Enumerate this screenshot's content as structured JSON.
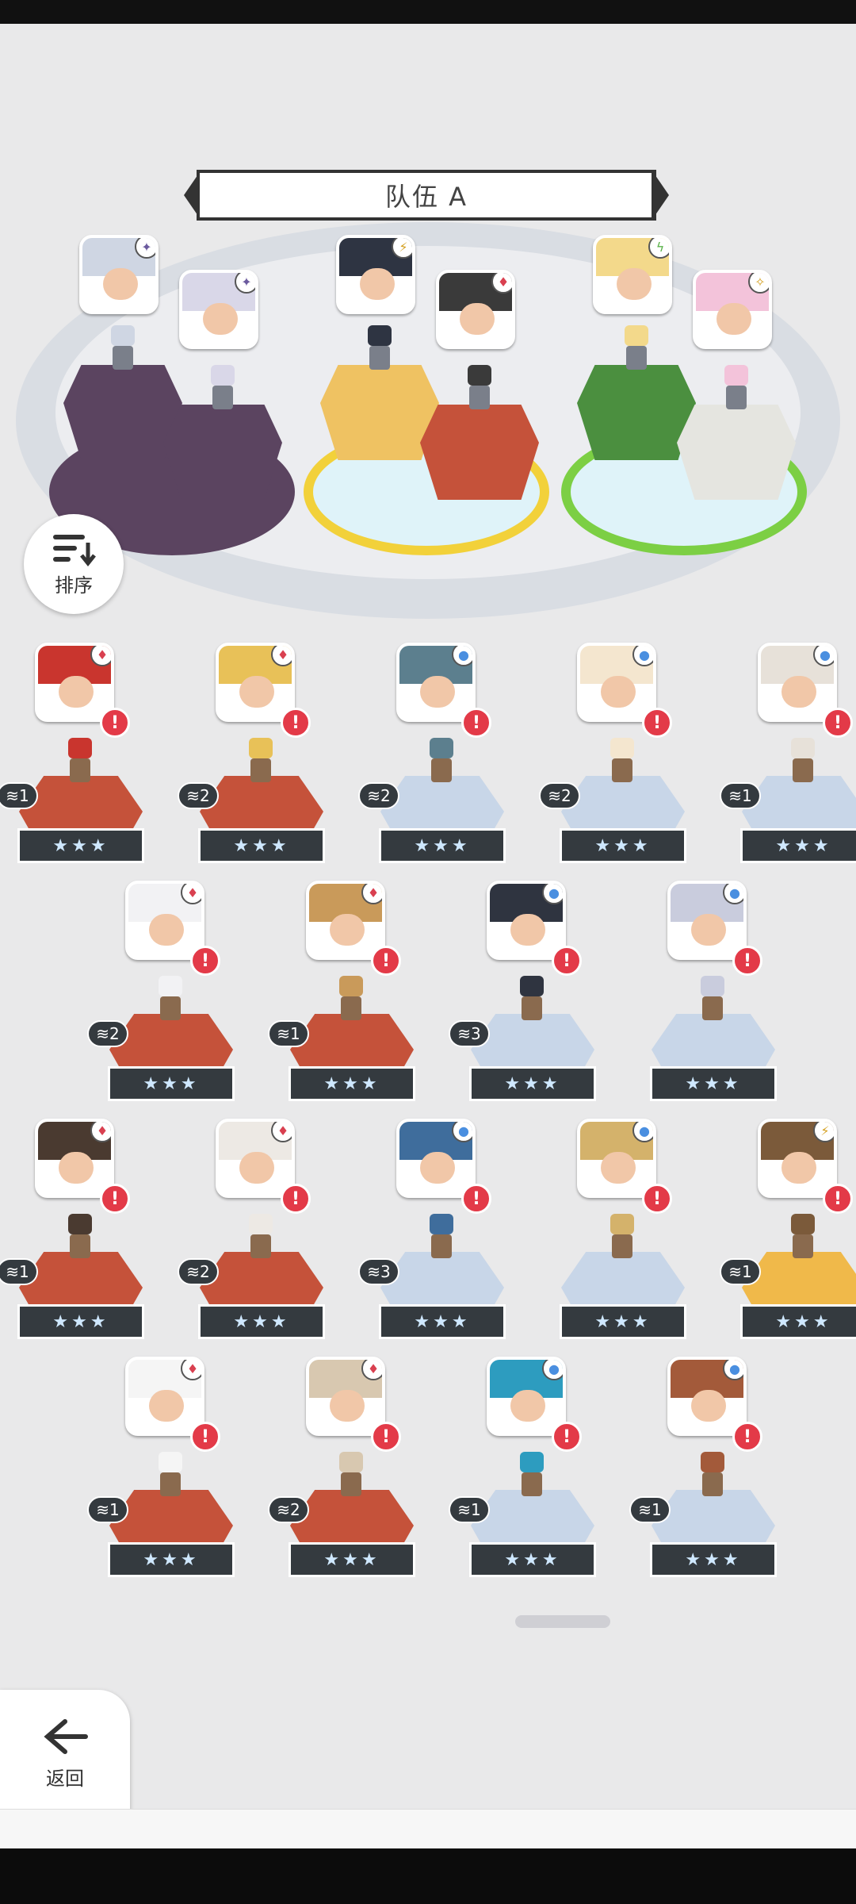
{
  "team": {
    "title": "队伍 A",
    "slots": [
      {
        "portrait_hair": "#cfd6e3",
        "elem": "✦",
        "elem_color": "#6b5a9e"
      },
      {
        "portrait_hair": "#d9d7e8",
        "elem": "✦",
        "elem_color": "#6b5a9e"
      },
      {
        "portrait_hair": "#2e3442",
        "elem": "⚡",
        "elem_color": "#d4a020"
      },
      {
        "portrait_hair": "#3a3a3a",
        "elem": "♦",
        "elem_color": "#d94050"
      },
      {
        "portrait_hair": "#f3d98b",
        "elem": "ϟ",
        "elem_color": "#5cb34a"
      },
      {
        "portrait_hair": "#f3c3da",
        "elem": "✧",
        "elem_color": "#d4a020"
      }
    ]
  },
  "sort_button": {
    "label": "排序"
  },
  "back_button": {
    "label": "返回"
  },
  "roster": [
    {
      "hair": "#c9352e",
      "elem": "♦",
      "ped": "red",
      "level": "1"
    },
    {
      "hair": "#e8c158",
      "elem": "♦",
      "ped": "red",
      "level": "2"
    },
    {
      "hair": "#5c7f8e",
      "elem": "●",
      "ped": "blue",
      "level": "2"
    },
    {
      "hair": "#f4e6cf",
      "elem": "●",
      "ped": "blue",
      "level": "2"
    },
    {
      "hair": "#e7e1d9",
      "elem": "●",
      "ped": "blue",
      "level": "1"
    },
    {
      "hair": "#f2f2f4",
      "elem": "♦",
      "ped": "red",
      "level": "2"
    },
    {
      "hair": "#c99a5a",
      "elem": "♦",
      "ped": "red",
      "level": "1"
    },
    {
      "hair": "#2f3440",
      "elem": "●",
      "ped": "blue",
      "level": "3"
    },
    {
      "hair": "#c9ccdd",
      "elem": "●",
      "ped": "blue",
      "level": ""
    },
    {
      "hair": "#4a3a30",
      "elem": "♦",
      "ped": "red",
      "level": "1"
    },
    {
      "hair": "#ede9e4",
      "elem": "♦",
      "ped": "red",
      "level": "2"
    },
    {
      "hair": "#3f6d9c",
      "elem": "●",
      "ped": "blue",
      "level": "3"
    },
    {
      "hair": "#d4b26b",
      "elem": "●",
      "ped": "blue",
      "level": ""
    },
    {
      "hair": "#7b5a3a",
      "elem": "⚡",
      "ped": "gold",
      "level": "1"
    },
    {
      "hair": "#f5f5f5",
      "elem": "♦",
      "ped": "red",
      "level": "1"
    },
    {
      "hair": "#d8c8b0",
      "elem": "♦",
      "ped": "red",
      "level": "2"
    },
    {
      "hair": "#2d9cbf",
      "elem": "●",
      "ped": "blue",
      "level": "1"
    },
    {
      "hair": "#a35a3a",
      "elem": "●",
      "ped": "blue",
      "level": "1"
    }
  ],
  "stars_label": "★★★",
  "alert_glyph": "!",
  "colors": {
    "red_ped": "#c5523a",
    "blue_ped": "#c8d6e8",
    "gold_ped": "#f0b94a",
    "purple_team": "#5b4460",
    "yellow_team": "#efc262",
    "green_team": "#4b8f3f"
  }
}
